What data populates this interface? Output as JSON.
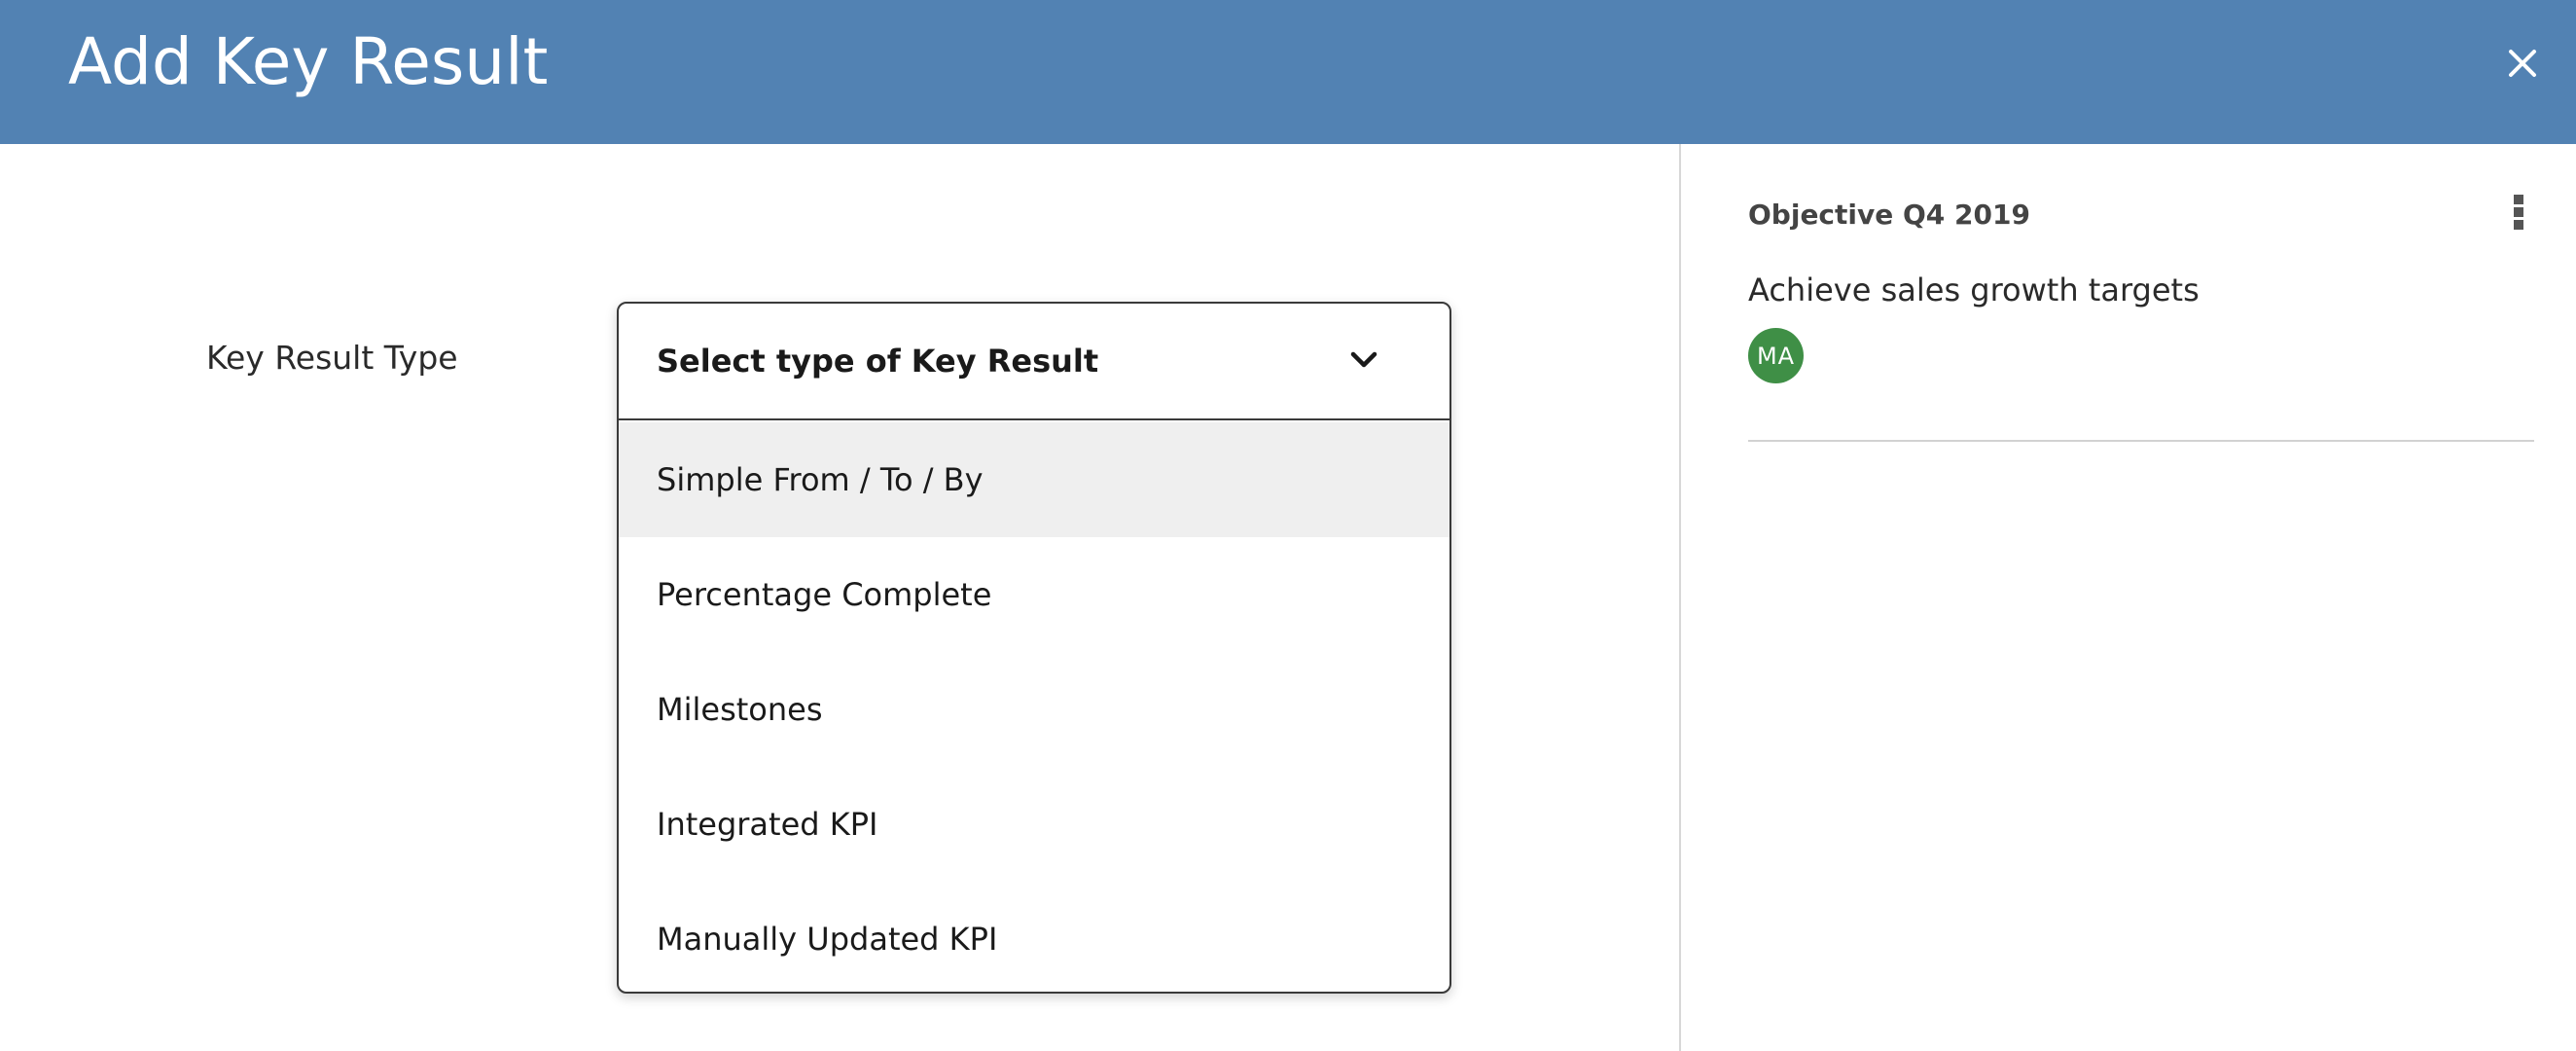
{
  "header": {
    "title": "Add Key Result",
    "close_icon": "close-icon",
    "background_color": "#5282b3"
  },
  "form": {
    "key_result_type_label": "Key Result Type",
    "select": {
      "value": "Select type of Key Result",
      "chevron_icon": "chevron-down-icon",
      "expanded": true,
      "options": [
        {
          "label": "Simple From / To / By",
          "highlighted": true
        },
        {
          "label": "Percentage Complete",
          "highlighted": false
        },
        {
          "label": "Milestones",
          "highlighted": false
        },
        {
          "label": "Integrated KPI",
          "highlighted": false
        },
        {
          "label": "Manually Updated KPI",
          "highlighted": false
        }
      ]
    }
  },
  "sidebar": {
    "heading": "Objective Q4 2019",
    "menu_icon": "more-vertical-icon",
    "objective_title": "Achieve sales growth targets",
    "owner_avatar": {
      "initials": "MA",
      "color": "#3f8f46"
    }
  }
}
